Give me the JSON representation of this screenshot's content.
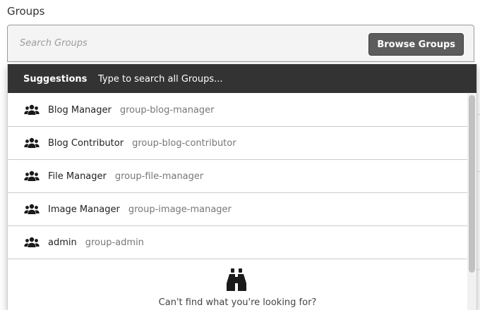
{
  "field": {
    "label": "Groups",
    "search_placeholder": "Search Groups",
    "browse_label": "Browse Groups"
  },
  "dropdown": {
    "title": "Suggestions",
    "hint": "Type to search all Groups...",
    "items": [
      {
        "name": "Blog Manager",
        "key": "group-blog-manager",
        "icon": "users-icon"
      },
      {
        "name": "Blog Contributor",
        "key": "group-blog-contributor",
        "icon": "users-icon"
      },
      {
        "name": "File Manager",
        "key": "group-file-manager",
        "icon": "users-icon"
      },
      {
        "name": "Image Manager",
        "key": "group-image-manager",
        "icon": "users-icon"
      },
      {
        "name": "admin",
        "key": "group-admin",
        "icon": "users-icon"
      }
    ],
    "footer_message": "Can't find what you're looking for?",
    "footer_icon": "binoculars-icon"
  },
  "colors": {
    "header_bg": "#333333",
    "button_bg": "#5c5c5c"
  }
}
